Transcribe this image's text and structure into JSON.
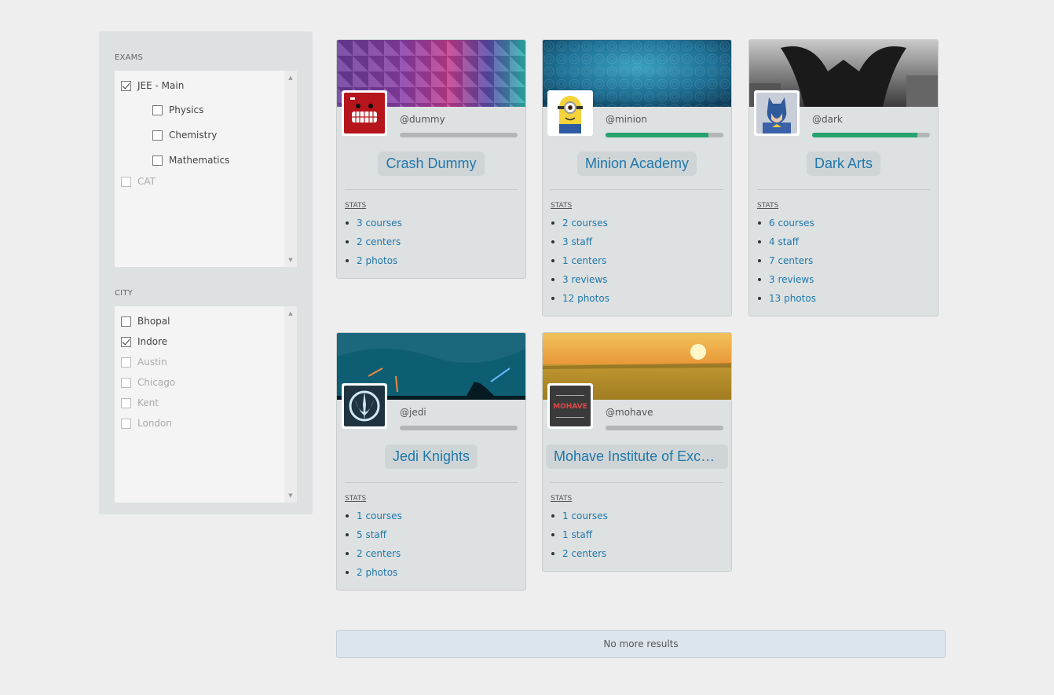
{
  "sidebar": {
    "exams": {
      "title": "EXAMS",
      "options": [
        {
          "label": "JEE - Main",
          "checked": true,
          "disabled": false,
          "level": 0
        },
        {
          "label": "Physics",
          "checked": false,
          "disabled": false,
          "level": 1
        },
        {
          "label": "Chemistry",
          "checked": false,
          "disabled": false,
          "level": 1
        },
        {
          "label": "Mathematics",
          "checked": false,
          "disabled": false,
          "level": 1
        },
        {
          "label": "CAT",
          "checked": false,
          "disabled": true,
          "level": 0
        }
      ]
    },
    "city": {
      "title": "CITY",
      "options": [
        {
          "label": "Bhopal",
          "checked": false,
          "disabled": false
        },
        {
          "label": "Indore",
          "checked": true,
          "disabled": false
        },
        {
          "label": "Austin",
          "checked": false,
          "disabled": true
        },
        {
          "label": "Chicago",
          "checked": false,
          "disabled": true
        },
        {
          "label": "Kent",
          "checked": false,
          "disabled": true
        },
        {
          "label": "London",
          "checked": false,
          "disabled": true
        }
      ]
    }
  },
  "cards": [
    {
      "handle": "@dummy",
      "name": "Crash Dummy",
      "progress": 0.0,
      "stats_label": "STATS",
      "stats": [
        "3 courses",
        "2 centers",
        "2 photos"
      ]
    },
    {
      "handle": "@minion",
      "name": "Minion Academy",
      "progress": 0.87,
      "stats_label": "STATS",
      "stats": [
        "2 courses",
        "3 staff",
        "1 centers",
        "3 reviews",
        "12 photos"
      ]
    },
    {
      "handle": "@dark",
      "name": "Dark Arts",
      "progress": 0.89,
      "stats_label": "STATS",
      "stats": [
        "6 courses",
        "4 staff",
        "7 centers",
        "3 reviews",
        "13 photos"
      ]
    },
    {
      "handle": "@jedi",
      "name": "Jedi Knights",
      "progress": 0.0,
      "stats_label": "STATS",
      "stats": [
        "1 courses",
        "5 staff",
        "2 centers",
        "2 photos"
      ]
    },
    {
      "handle": "@mohave",
      "name": "Mohave Institute of Excellence",
      "progress": 0.0,
      "logo_text": "MOHAVE",
      "stats_label": "STATS",
      "stats": [
        "1 courses",
        "1 staff",
        "2 centers"
      ]
    }
  ],
  "footer": {
    "no_more": "No more results"
  },
  "colors": {
    "link": "#2178ac",
    "progress": "#27a36e",
    "panel": "#dde1e1"
  }
}
